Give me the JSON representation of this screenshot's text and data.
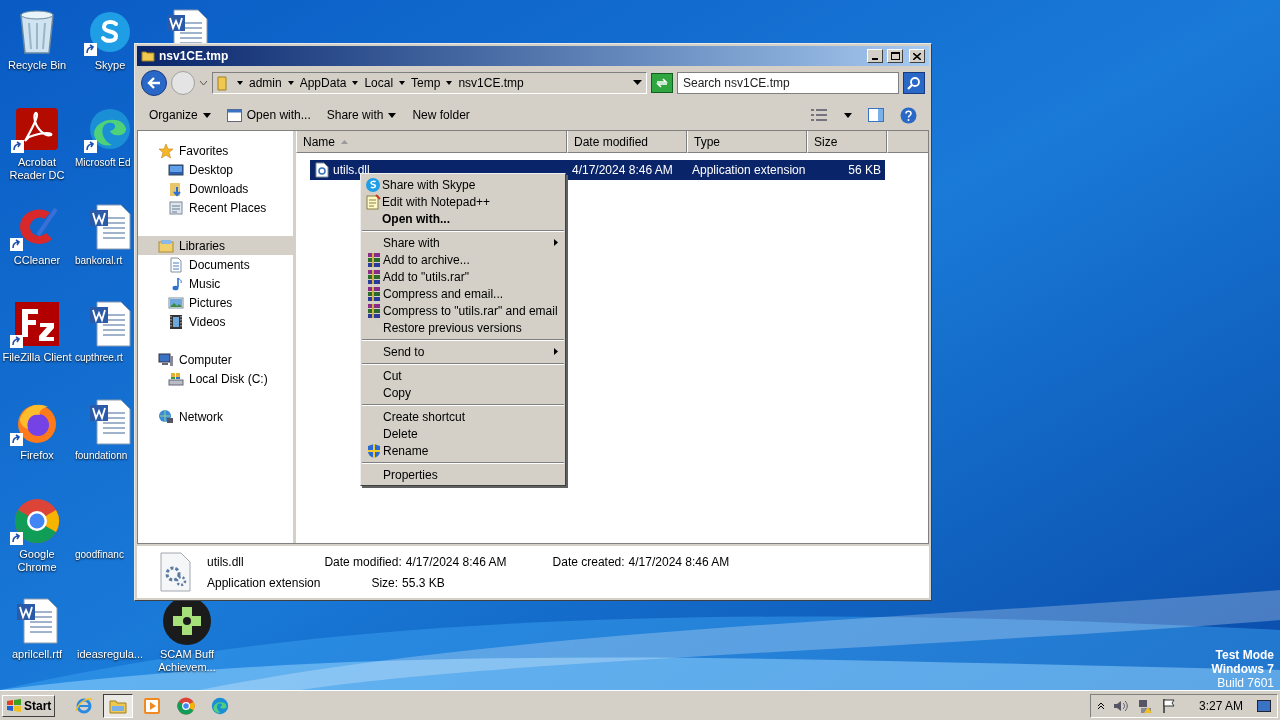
{
  "desktop": {
    "icons": [
      {
        "kind": "recycle",
        "label": "Recycle Bin",
        "shortcut": false
      },
      {
        "kind": "skype",
        "label": "Skype",
        "shortcut": true
      },
      {
        "kind": "word"
      },
      {
        "kind": "acrobat",
        "label": "Acrobat Reader DC",
        "shortcut": true
      },
      {
        "kind": "edge",
        "label": "Microsoft Ed",
        "shortcut": true
      },
      {
        "kind": "ccleaner",
        "label": "CCleaner",
        "shortcut": true
      },
      {
        "kind": "word",
        "label": "bankoral.rt",
        "shortcut": false
      },
      {
        "kind": "filezilla",
        "label": "FileZilla Client",
        "shortcut": true
      },
      {
        "kind": "word",
        "label": "cupthree.rt",
        "shortcut": false
      },
      {
        "kind": "firefox",
        "label": "Firefox",
        "shortcut": true
      },
      {
        "kind": "word",
        "label": "foundationn",
        "shortcut": false
      },
      {
        "kind": "chrome",
        "label": "Google Chrome",
        "shortcut": true
      },
      {
        "kind": "blank",
        "label": "goodfinanc",
        "shortcut": false
      },
      {
        "kind": "word",
        "label": "aprilcell.rtf",
        "shortcut": false
      },
      {
        "kind": "blank",
        "label": "ideasregula...",
        "shortcut": false
      },
      {
        "kind": "game",
        "label": "SCAM Buff Achievem...",
        "shortcut": false
      }
    ],
    "system_notice": [
      "Test Mode",
      "Windows 7",
      "Build 7601"
    ]
  },
  "window": {
    "title": "nsv1CE.tmp",
    "breadcrumb": [
      "admin",
      "AppData",
      "Local",
      "Temp",
      "nsv1CE.tmp"
    ],
    "search": {
      "placeholder": "Search nsv1CE.tmp"
    },
    "toolbar": [
      {
        "label": "Organize",
        "dropdown": true,
        "icon": false
      },
      {
        "label": "Open with...",
        "dropdown": false,
        "icon": true
      },
      {
        "label": "Share with",
        "dropdown": true,
        "icon": false
      },
      {
        "label": "New folder",
        "dropdown": false,
        "icon": false
      }
    ],
    "nav": [
      {
        "kind": "star",
        "label": "Favorites",
        "selected": false,
        "children": [
          {
            "kind": "desktop",
            "label": "Desktop",
            "selected": false
          },
          {
            "kind": "downloads",
            "label": "Downloads",
            "selected": false
          },
          {
            "kind": "recent",
            "label": "Recent Places",
            "selected": false
          }
        ]
      },
      {
        "kind": "libraries",
        "label": "Libraries",
        "selected": true,
        "children": [
          {
            "kind": "documents",
            "label": "Documents",
            "selected": false
          },
          {
            "kind": "music",
            "label": "Music",
            "selected": false
          },
          {
            "kind": "pictures",
            "label": "Pictures",
            "selected": false
          },
          {
            "kind": "videos",
            "label": "Videos",
            "selected": false
          }
        ]
      },
      {
        "kind": "computer",
        "label": "Computer",
        "selected": false,
        "children": [
          {
            "kind": "disk",
            "label": "Local Disk (C:)",
            "selected": false
          }
        ]
      },
      {
        "kind": "network",
        "label": "Network",
        "selected": false
      }
    ],
    "table": {
      "columns": [
        {
          "label": "Name",
          "sorted": true
        },
        {
          "label": "Date modified",
          "sorted": false
        },
        {
          "label": "Type",
          "sorted": false
        },
        {
          "label": "Size",
          "sorted": false
        }
      ],
      "rows": [
        {
          "name": "utils.dll",
          "date": "4/17/2024 8:46 AM",
          "type": "Application extension",
          "size": "56 KB",
          "selected": true
        }
      ]
    },
    "context_menu": [
      [
        {
          "label": "Share with Skype",
          "kind": "skype",
          "bold": false,
          "submenu": false
        },
        {
          "label": "Edit with Notepad++",
          "kind": "notepad",
          "bold": false,
          "submenu": false
        },
        {
          "label": "Open with...",
          "kind": "plain",
          "bold": true,
          "submenu": false
        }
      ],
      [
        {
          "label": "Share with",
          "kind": "plain",
          "bold": false,
          "submenu": true
        },
        {
          "label": "Add to archive...",
          "kind": "winrar",
          "bold": false,
          "submenu": false
        },
        {
          "label": "Add to \"utils.rar\"",
          "kind": "winrar",
          "bold": false,
          "submenu": false
        },
        {
          "label": "Compress and email...",
          "kind": "winrar",
          "bold": false,
          "submenu": false
        },
        {
          "label": "Compress to \"utils.rar\" and email",
          "kind": "winrar",
          "bold": false,
          "submenu": false
        },
        {
          "label": "Restore previous versions",
          "kind": "plain",
          "bold": false,
          "submenu": false
        }
      ],
      [
        {
          "label": "Send to",
          "kind": "plain",
          "bold": false,
          "submenu": true
        }
      ],
      [
        {
          "label": "Cut",
          "kind": "plain",
          "bold": false,
          "submenu": false
        },
        {
          "label": "Copy",
          "kind": "plain",
          "bold": false,
          "submenu": false
        }
      ],
      [
        {
          "label": "Create shortcut",
          "kind": "plain",
          "bold": false,
          "submenu": false
        },
        {
          "label": "Delete",
          "kind": "plain",
          "bold": false,
          "submenu": false
        },
        {
          "label": "Rename",
          "kind": "shield",
          "bold": false,
          "submenu": false
        }
      ],
      [
        {
          "label": "Properties",
          "kind": "plain",
          "bold": false,
          "submenu": false
        }
      ]
    ],
    "details": {
      "name": "utils.dll",
      "type": "Application extension",
      "fields": [
        {
          "label": "Date modified:",
          "value": "4/17/2024 8:46 AM"
        },
        {
          "label": "Size:",
          "value": "55.3 KB"
        },
        {
          "label": "Date created:",
          "value": "4/17/2024 8:46 AM"
        }
      ]
    }
  },
  "taskbar": {
    "start": "Start",
    "apps": [
      {
        "kind": "ie",
        "selected": false
      },
      {
        "kind": "explorer",
        "selected": true
      },
      {
        "kind": "media",
        "selected": false
      },
      {
        "kind": "chrome",
        "selected": false
      },
      {
        "kind": "edge",
        "selected": false
      }
    ],
    "time": "3:27 AM"
  }
}
